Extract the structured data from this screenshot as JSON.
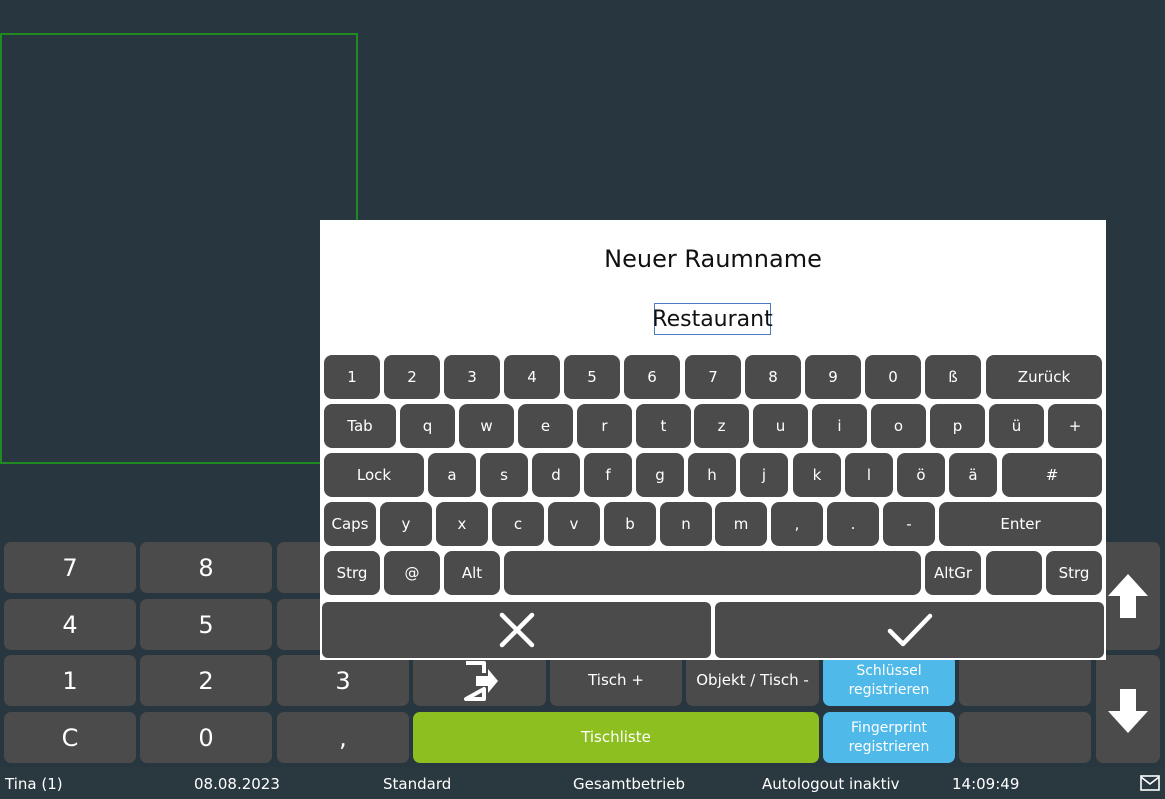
{
  "numpad": {
    "row1": [
      "7",
      "8"
    ],
    "row2": [
      "4",
      "5"
    ],
    "row3": [
      "1",
      "2",
      "3"
    ],
    "row4": [
      "C",
      "0",
      ","
    ]
  },
  "actions": {
    "table_plus": "Tisch +",
    "object_table_minus": "Objekt / Tisch -",
    "key_register_line1": "Schlüssel",
    "key_register_line2": "registrieren",
    "table_list": "Tischliste",
    "fingerprint_line1": "Fingerprint",
    "fingerprint_line2": "registrieren"
  },
  "status_bar": {
    "user": "Tina (1)",
    "date": "08.08.2023",
    "mode": "Standard",
    "operation": "Gesamtbetrieb",
    "autologout": "Autologout inaktiv",
    "time": "14:09:49"
  },
  "dialog": {
    "title": "Neuer Raumname",
    "input_value": "Restaurant",
    "keyboard": {
      "row1": [
        "1",
        "2",
        "3",
        "4",
        "5",
        "6",
        "7",
        "8",
        "9",
        "0",
        "ß"
      ],
      "back": "Zurück",
      "tab": "Tab",
      "row2": [
        "q",
        "w",
        "e",
        "r",
        "t",
        "z",
        "u",
        "i",
        "o",
        "p",
        "ü",
        "+"
      ],
      "lock": "Lock",
      "row3": [
        "a",
        "s",
        "d",
        "f",
        "g",
        "h",
        "j",
        "k",
        "l",
        "ö",
        "ä",
        "#"
      ],
      "caps": "Caps",
      "row4": [
        "y",
        "x",
        "c",
        "v",
        "b",
        "n",
        "m",
        ",",
        ".",
        "-"
      ],
      "enter": "Enter",
      "ctrl": "Strg",
      "at": "@",
      "alt": "Alt",
      "altgr": "AltGr",
      "ctrl_right": "Strg"
    }
  },
  "colors": {
    "background": "#27363f",
    "key": "#4b4b4b",
    "accent_green": "#8cbf1f",
    "accent_blue": "#4fb9e9",
    "room_border": "#1f8a22"
  },
  "icons": {
    "cancel": "close-icon",
    "confirm": "check-icon",
    "up": "arrow-up-icon",
    "down": "arrow-down-icon",
    "exit": "exit-door-icon",
    "mail": "mail-icon"
  }
}
